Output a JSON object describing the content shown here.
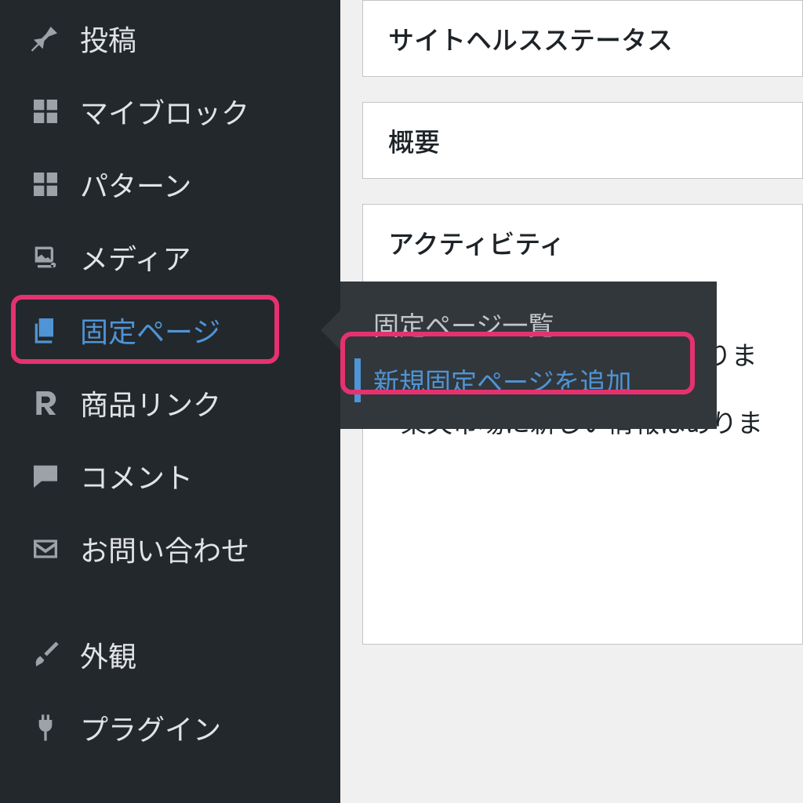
{
  "sidebar": {
    "items": [
      {
        "label": "投稿"
      },
      {
        "label": "マイブロック"
      },
      {
        "label": "パターン"
      },
      {
        "label": "メディア"
      },
      {
        "label": "固定ページ"
      },
      {
        "label": "商品リンク"
      },
      {
        "label": "コメント"
      },
      {
        "label": "お問い合わせ"
      },
      {
        "label": "外観"
      },
      {
        "label": "プラグイン"
      }
    ]
  },
  "flyout": {
    "items": [
      {
        "label": "固定ページ一覧"
      },
      {
        "label": "新規固定ページを追加"
      }
    ]
  },
  "main": {
    "site_health_title": "サイトヘルスステータス",
    "overview_title": "概要",
    "activity_title": "アクティビティ",
    "activity_line1": "Amazonに新しい情報はありま",
    "activity_line2": "楽天市場に新しい情報はありま"
  }
}
